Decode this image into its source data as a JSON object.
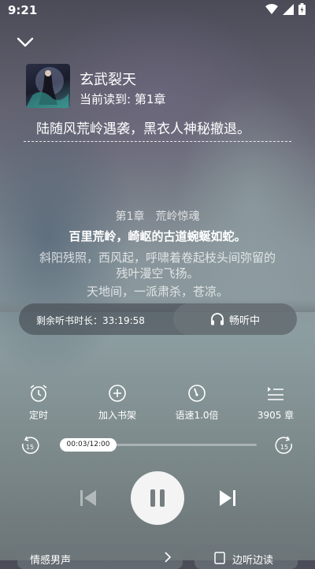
{
  "status_bar": {
    "time": "9:21"
  },
  "book": {
    "title": "玄武裂天",
    "progress": "当前读到: 第1章",
    "summary": "陆随风荒岭遇袭，黑衣人神秘撤退。"
  },
  "lyrics": {
    "chapter_heading": "第1章　荒岭惊魂",
    "current": "百里荒岭，崎岖的古道蜿蜒如蛇。",
    "lines": [
      "斜阳残照，西风起，呼啸着卷起枝头间弥留的",
      "残叶漫空飞扬。",
      "天地间，一派肃杀，苍凉。"
    ]
  },
  "timer": {
    "text": "剩余听书时长：33:19:58"
  },
  "listen_button": {
    "label": "畅听中"
  },
  "actions": [
    {
      "icon": "alarm-clock-icon",
      "label": "定时"
    },
    {
      "icon": "add-circle-icon",
      "label": "加入书架"
    },
    {
      "icon": "speed-gauge-icon",
      "label": "语速1.0倍"
    },
    {
      "icon": "chapter-list-icon",
      "label": "3905 章"
    }
  ],
  "player": {
    "rewind_seconds": "15",
    "forward_seconds": "15",
    "position": "00:03/12:00",
    "progress_fraction": 0.004
  },
  "bottom": {
    "left_label": "情感男声",
    "right_label": "边听边读"
  }
}
